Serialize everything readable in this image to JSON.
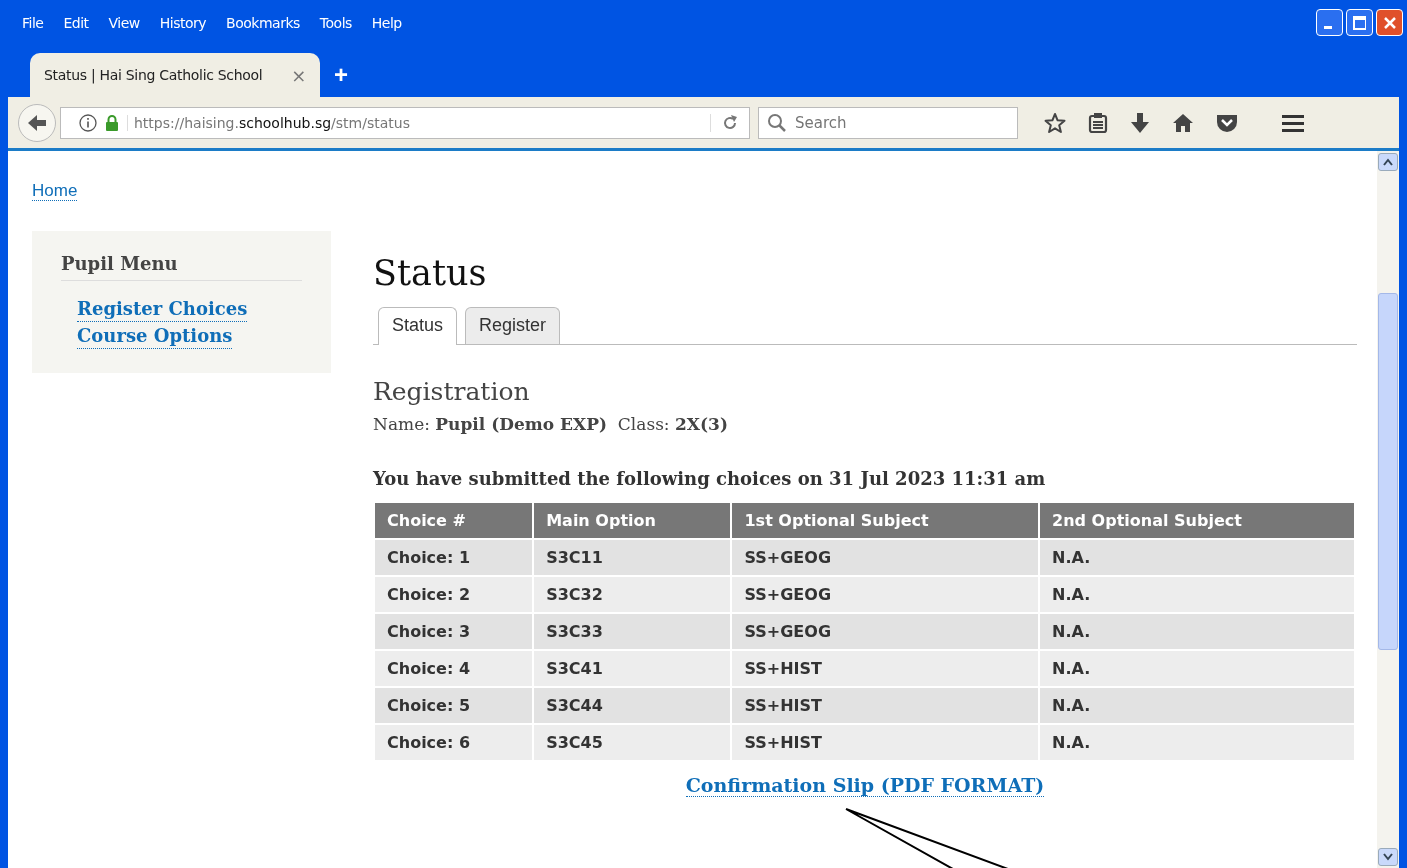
{
  "menu": [
    {
      "label": "File"
    },
    {
      "label": "Edit"
    },
    {
      "label": "View"
    },
    {
      "label": "History"
    },
    {
      "label": "Bookmarks"
    },
    {
      "label": "Tools"
    },
    {
      "label": "Help"
    }
  ],
  "browser_tab": {
    "title": "Status | Hai Sing Catholic School",
    "close": "×",
    "new_tab": "+"
  },
  "address_bar": {
    "url_prefix": "https://haising.",
    "url_domain": "schoolhub.sg",
    "url_path": "/stm/status"
  },
  "search": {
    "placeholder": "Search"
  },
  "breadcrumb": "Home",
  "sidebar": {
    "title": "Pupil Menu",
    "items": [
      {
        "label": "Register Choices"
      },
      {
        "label": "Course Options"
      }
    ]
  },
  "heading": "Status",
  "tabs": [
    {
      "label": "Status",
      "selected": true
    },
    {
      "label": "Register",
      "selected": false
    }
  ],
  "section_title": "Registration",
  "pupil_info": "Name: **Pupil (Demo EXP)**  Class: **2X(3)**",
  "submitted_note": "You have submitted the following choices on 31 Jul 2023 11:31 am",
  "table": {
    "columns": [
      "Choice #",
      "Main Option",
      "1st Optional Subject",
      "2nd Optional Subject"
    ],
    "rows": [
      [
        "Choice: 1",
        "S3C11",
        "SS+GEOG",
        "N.A."
      ],
      [
        "Choice: 2",
        "S3C32",
        "SS+GEOG",
        "N.A."
      ],
      [
        "Choice: 3",
        "S3C33",
        "SS+GEOG",
        "N.A."
      ],
      [
        "Choice: 4",
        "S3C41",
        "SS+HIST",
        "N.A."
      ],
      [
        "Choice: 5",
        "S3C44",
        "SS+HIST",
        "N.A."
      ],
      [
        "Choice: 6",
        "S3C45",
        "SS+HIST",
        "N.A."
      ]
    ]
  },
  "confirmation_link": "Confirmation Slip (PDF FORMAT)"
}
